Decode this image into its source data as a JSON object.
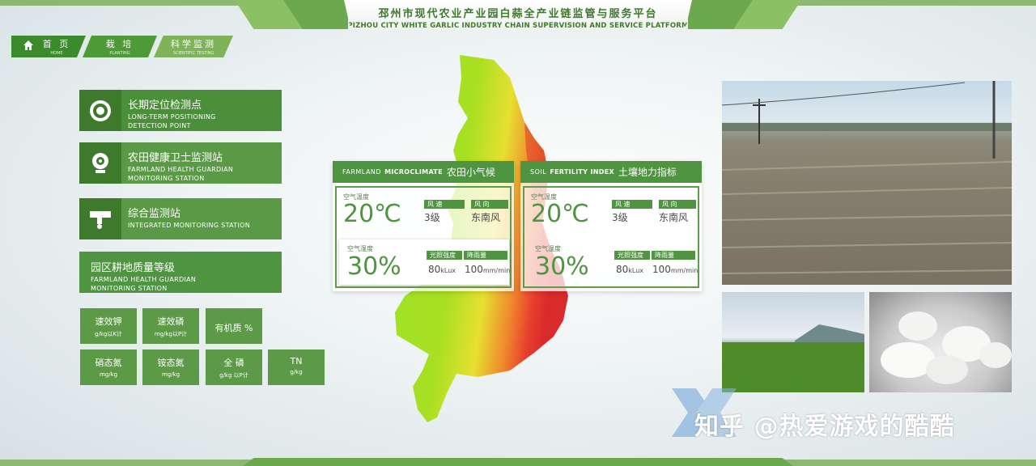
{
  "header": {
    "title_cn": "邳州市现代农业产业园白蒜全产业链监管与服务平台",
    "title_en": "PIZHOU CITY WHITE GARLIC INDUSTRY CHAIN SUPERVISION AND SERVICE PLATFORM"
  },
  "nav": {
    "tabs": [
      {
        "cn": "首 页",
        "en": "HOME"
      },
      {
        "cn": "栽 培",
        "en": "PLANTING"
      },
      {
        "cn": "科学监测",
        "en": "SCIENTIFIC TESTING"
      }
    ]
  },
  "stations": [
    {
      "cn": "长期定位检测点",
      "en1": "LONG-TERM POSITIONING",
      "en2": "DETECTION POINT",
      "icon": "target-icon"
    },
    {
      "cn": "农田健康卫士监测站",
      "en1": "FARMLAND HEALTH GUARDIAN",
      "en2": "MONITORING STATION",
      "icon": "camera-icon"
    },
    {
      "cn": "综合监测站",
      "en1": "INTEGRATED MONITORING STATION",
      "en2": "",
      "icon": "monitor-icon"
    },
    {
      "cn": "园区耕地质量等级",
      "en1": "FARMLAND HEALTH GUARDIAN",
      "en2": "MONITORING STATION"
    }
  ],
  "metrics": [
    {
      "cn": "速效钾",
      "unit": "g/kg以K计"
    },
    {
      "cn": "速效磷",
      "unit": "mg/kg以P计"
    },
    {
      "cn": "有机质 %",
      "unit": ""
    },
    {
      "cn": "硝态氮",
      "unit": "mg/kg"
    },
    {
      "cn": "铵态氮",
      "unit": "mg/kg"
    },
    {
      "cn": "全 磷",
      "unit": "g/kg 以P计"
    },
    {
      "cn": "TN",
      "unit": "g/kg"
    }
  ],
  "panels": [
    {
      "head_en1": "FARMLAND",
      "head_en2": "MICROCLIMATE",
      "head_cn": "农田小气候",
      "temp_label": "空气温度",
      "temp_value": "20℃",
      "wind_speed_label": "风 速",
      "wind_speed": "3级",
      "wind_dir_label": "风 向",
      "wind_dir": "东南风",
      "hum_label": "空气湿度",
      "hum_value": "30%",
      "light_label": "光照强度",
      "light_value": "80",
      "light_unit": "kLux",
      "rain_label": "降雨量",
      "rain_value": "100",
      "rain_unit": "mm/min"
    },
    {
      "head_en1": "SOIL",
      "head_en2": "FERTILITY INDEX",
      "head_cn": "土壤地力指标",
      "temp_label": "空气温度",
      "temp_value": "20℃",
      "wind_speed_label": "风 速",
      "wind_speed": "3级",
      "wind_dir_label": "风 向",
      "wind_dir": "东南风",
      "hum_label": "空气湿度",
      "hum_value": "30%",
      "light_label": "光照强度",
      "light_value": "80",
      "light_unit": "kLux",
      "rain_label": "降雨量",
      "rain_value": "100",
      "rain_unit": "mm/min"
    }
  ],
  "watermark": "知乎 @热爱游戏的酷酷",
  "colors": {
    "primary": "#4f9440",
    "dark": "#3d7a2b",
    "light": "#8cb874"
  }
}
